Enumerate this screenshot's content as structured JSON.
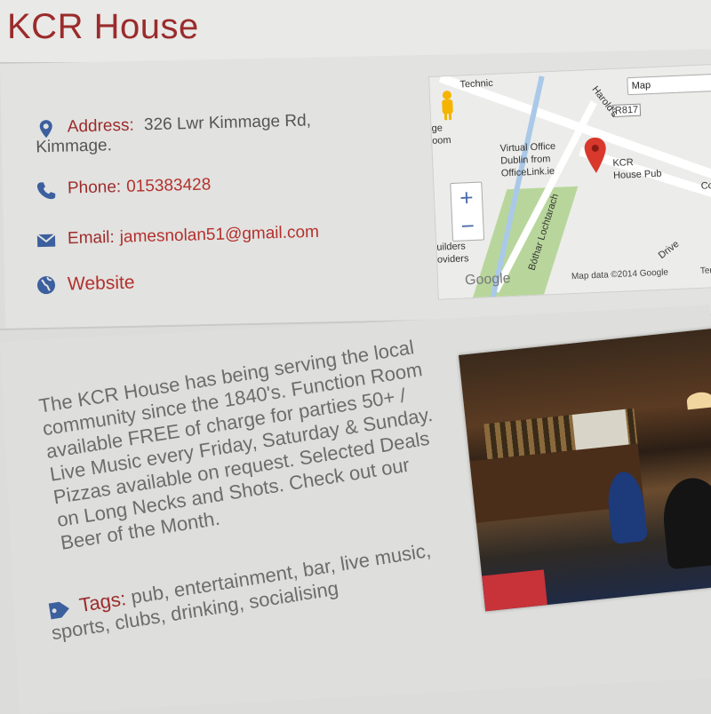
{
  "title": "KCR House",
  "contact": {
    "address_label": "Address:",
    "address_line1": "326 Lwr Kimmage Rd,",
    "address_line2": "Kimmage.",
    "phone_label": "Phone:",
    "phone_value": "015383428",
    "email_label": "Email:",
    "email_value": "jamesnolan51@gmail.com",
    "website_label": "Website"
  },
  "map": {
    "type_button": "Map",
    "labels": {
      "technic": "Technic",
      "ge": "ge",
      "oom": "oom",
      "virtual_office": "Virtual Office",
      "dublin_from": "Dublin from",
      "officelink": "OfficeLink.ie",
      "kcr": "KCR",
      "house_pub": "House Pub",
      "r817": "R817",
      "harolds": "Harold's",
      "builders": "uilders",
      "providers": "oviders",
      "bottom_road": "Bóthar Lochtarach",
      "drive": "Drive",
      "corner": "Co",
      "google": "Google",
      "map_data": "Map data ©2014 Google",
      "terms": "Terr"
    },
    "colors": {
      "pin": "#d9382c",
      "park": "#b8d69b",
      "water": "#aac9e8"
    }
  },
  "description": "The KCR House has being serving the local community since the 1840's. Function Room available FREE of charge for parties 50+ / Live Music every Friday, Saturday & Sunday. Pizzas available on request. Selected Deals on Long Necks and Shots. Check out our Beer of the Month.",
  "tags": {
    "label": "Tags:",
    "value": "pub, entertainment, bar, live music, sports, clubs, drinking, socialising"
  },
  "icons": {
    "address": "map-pin-icon",
    "phone": "phone-icon",
    "email": "envelope-icon",
    "website": "globe-icon",
    "tags": "tag-icon"
  },
  "colors": {
    "accent": "#9b2b2b",
    "icon": "#3c5f9e",
    "text": "#6c6c6c"
  }
}
